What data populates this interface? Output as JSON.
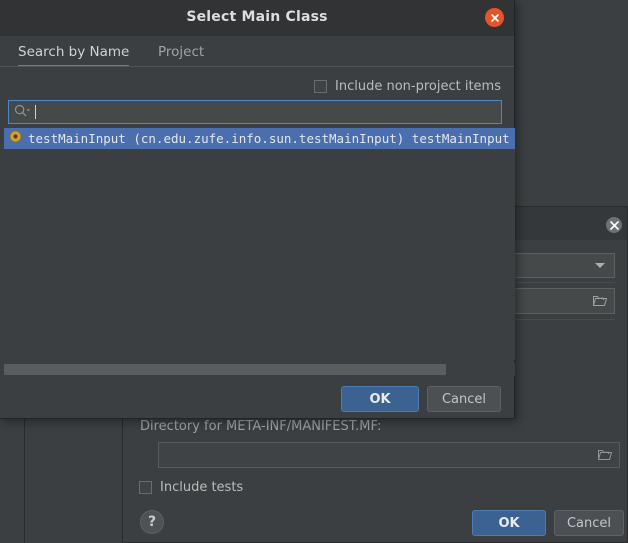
{
  "ide": {
    "background_color": "#3c3f41"
  },
  "background_dialog": {
    "close_icon": "close-icon",
    "combo": {
      "selected_value": "",
      "chevron_icon": "chevron-down-icon"
    },
    "path_field": {
      "value": "",
      "browse_icon": "folder-icon"
    },
    "manifest_label": "Directory for META-INF/MANIFEST.MF:",
    "manifest_field": {
      "value": "",
      "browse_icon": "folder-icon"
    },
    "include_tests": {
      "label": "Include tests",
      "checked": false
    },
    "help_label": "?",
    "ok_label": "OK",
    "cancel_label": "Cancel"
  },
  "dialog": {
    "title": "Select Main Class",
    "close_icon": "close-icon",
    "tabs": [
      {
        "label": "Search by Name",
        "active": true
      },
      {
        "label": "Project",
        "active": false
      }
    ],
    "include_non_project": {
      "label": "Include non-project items",
      "checked": false
    },
    "search": {
      "icon": "search-icon",
      "value": "",
      "placeholder": ""
    },
    "results": [
      {
        "icon": "class-icon",
        "text": "testMainInput (cn.edu.zufe.info.sun.testMainInput) testMainInput"
      }
    ],
    "scrollbar": {
      "orientation": "horizontal"
    },
    "ok_label": "OK",
    "cancel_label": "Cancel"
  },
  "colors": {
    "accent_blue": "#4a88c7",
    "selection_blue": "#4b6eaf",
    "close_orange": "#e8542a",
    "panel": "#3c3f41",
    "titlebar": "#313335"
  }
}
